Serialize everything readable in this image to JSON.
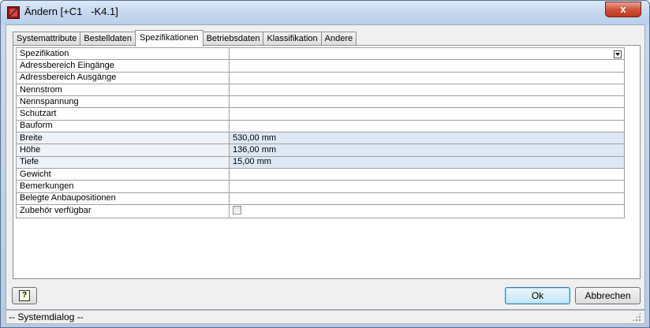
{
  "window": {
    "title": "Ändern [+C1   -K4.1]",
    "close_label": "x"
  },
  "tabs": [
    {
      "label": "Systemattribute",
      "active": false
    },
    {
      "label": "Bestelldaten",
      "active": false
    },
    {
      "label": "Spezifikationen",
      "active": true
    },
    {
      "label": "Betriebsdaten",
      "active": false
    },
    {
      "label": "Klassifikation",
      "active": false
    },
    {
      "label": "Andere",
      "active": false
    }
  ],
  "grid": {
    "header": {
      "label": "Spezifikation",
      "value": ""
    },
    "rows": [
      {
        "label": "Adressbereich Eingänge",
        "value": ""
      },
      {
        "label": "Adressbereich Ausgänge",
        "value": ""
      },
      {
        "label": "Nennstrom",
        "value": ""
      },
      {
        "label": "Nennspannung",
        "value": ""
      },
      {
        "label": "Schutzart",
        "value": ""
      },
      {
        "label": "Bauform",
        "value": ""
      },
      {
        "label": "Breite",
        "value": "530,00 mm"
      },
      {
        "label": "Höhe",
        "value": "136,00 mm"
      },
      {
        "label": "Tiefe",
        "value": "15,00 mm"
      },
      {
        "label": "Gewicht",
        "value": ""
      },
      {
        "label": "Bemerkungen",
        "value": ""
      },
      {
        "label": "Belegte Anbaupositionen",
        "value": ""
      },
      {
        "label": "Zubehör verfügbar",
        "value": ""
      }
    ],
    "checkbox_checked": false
  },
  "buttons": {
    "help_label": "?",
    "ok_label": "Ok",
    "cancel_label": "Abbrechen"
  },
  "status": {
    "text": "-- Systemdialog --"
  },
  "colors": {
    "highlight_row": "#dde8f5",
    "title_bar": "#c4d7ef",
    "close_button": "#d0523b"
  }
}
